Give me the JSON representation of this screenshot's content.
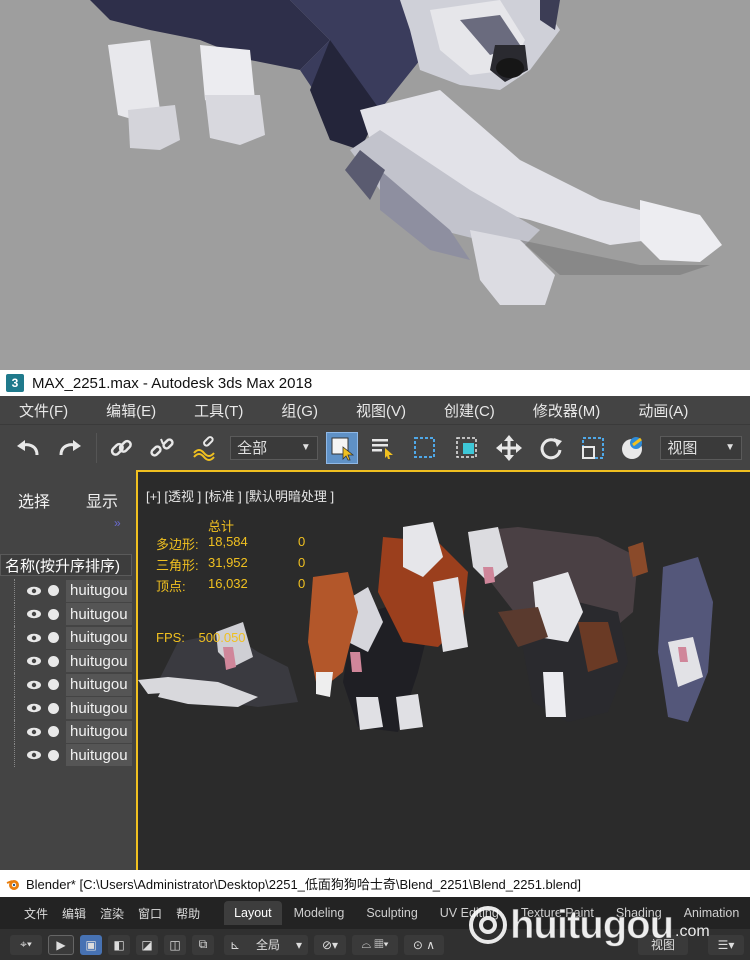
{
  "max": {
    "window_title": "MAX_2251.max - Autodesk 3ds Max 2018",
    "app_icon": "3",
    "menu": [
      "文件(F)",
      "编辑(E)",
      "工具(T)",
      "组(G)",
      "视图(V)",
      "创建(C)",
      "修改器(M)",
      "动画(A)"
    ],
    "toolbar": {
      "selection_filter": "全部",
      "reference_coord": "视图"
    },
    "left_panel": {
      "tab_select": "选择",
      "tab_display": "显示",
      "collapse_glyph": "»",
      "list_header": "名称(按升序排序)",
      "items": [
        "huitugou",
        "huitugou",
        "huitugou",
        "huitugou",
        "huitugou",
        "huitugou",
        "huitugou",
        "huitugou"
      ]
    },
    "viewport": {
      "label": "[+] [透视 ] [标准 ] [默认明暗处理 ]",
      "stats": {
        "total_label": "总计",
        "rows": [
          {
            "label": "多边形:",
            "value": "18,584",
            "sel": "0"
          },
          {
            "label": "三角形:",
            "value": "31,952",
            "sel": "0"
          },
          {
            "label": "顶点:",
            "value": "16,032",
            "sel": "0"
          }
        ],
        "fps_label": "FPS:",
        "fps_value": "500.050"
      }
    }
  },
  "blender": {
    "window_title": "Blender* [C:\\Users\\Administrator\\Desktop\\2251_低面狗狗哈士奇\\Blend_2251\\Blend_2251.blend]",
    "menu": [
      "文件",
      "编辑",
      "渲染",
      "窗口",
      "帮助"
    ],
    "workspaces": [
      "Layout",
      "Modeling",
      "Sculpting",
      "UV Editing",
      "Texture Paint",
      "Shading",
      "Animation"
    ],
    "active_workspace": "Layout",
    "header": {
      "transform_orientation": "全局",
      "view_label": "视图"
    }
  },
  "watermark": {
    "text": "huitugou",
    "suffix": ".com"
  },
  "colors": {
    "max_ui": "#444444",
    "viewport_bg": "#2b2b2b",
    "stats_text": "#f0c020",
    "active_tool": "#5f91c6",
    "blender_bg": "#232323",
    "render_bg": "#9e9e9e"
  }
}
